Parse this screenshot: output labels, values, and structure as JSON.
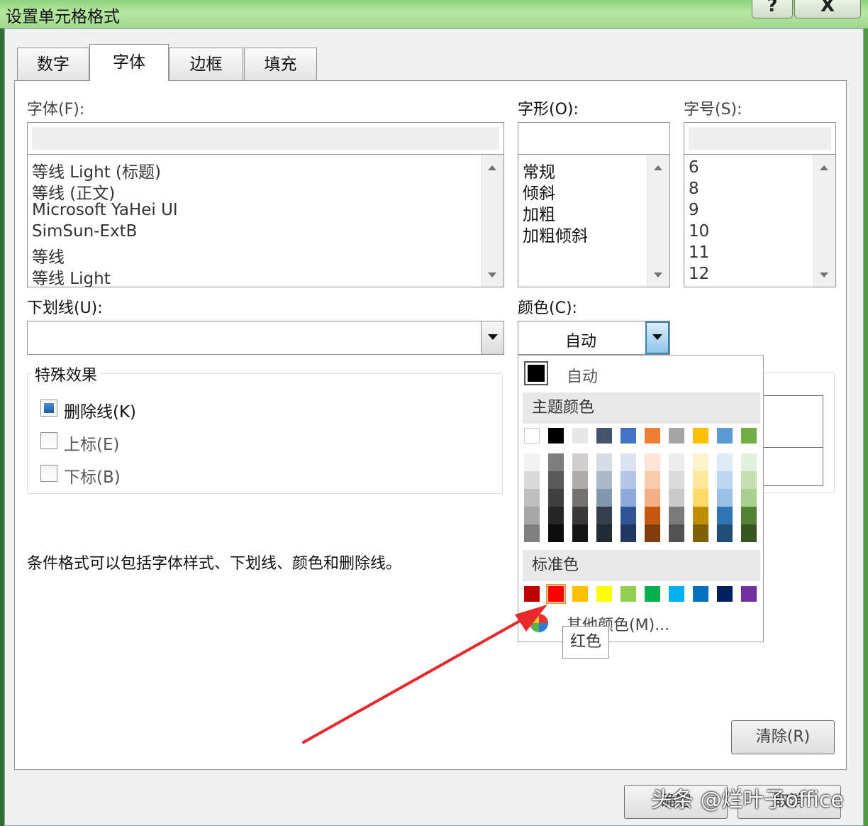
{
  "window": {
    "title": "设置单元格格式",
    "help_glyph": "?",
    "close_glyph": "X"
  },
  "tabs": [
    {
      "label": "数字",
      "active": false
    },
    {
      "label": "字体",
      "active": true
    },
    {
      "label": "边框",
      "active": false
    },
    {
      "label": "填充",
      "active": false
    }
  ],
  "font": {
    "label": "字体(F):",
    "value": "",
    "items": [
      "等线 Light (标题)",
      "等线 (正文)",
      "Microsoft YaHei UI",
      "SimSun-ExtB",
      "等线",
      "等线 Light"
    ]
  },
  "style": {
    "label": "字形(O):",
    "value": "",
    "items": [
      "常规",
      "倾斜",
      "加粗",
      "加粗倾斜"
    ]
  },
  "size": {
    "label": "字号(S):",
    "value": "",
    "items": [
      "6",
      "8",
      "9",
      "10",
      "11",
      "12"
    ]
  },
  "underline": {
    "label": "下划线(U):",
    "value": ""
  },
  "color": {
    "label": "颜色(C):",
    "value": "自动"
  },
  "effects": {
    "title": "特殊效果",
    "strikethrough": {
      "label": "删除线(K)",
      "checked": true
    },
    "superscript": {
      "label": "上标(E)",
      "checked": false
    },
    "subscript": {
      "label": "下标(B)",
      "checked": false
    }
  },
  "note": "条件格式可以包括字体样式、下划线、颜色和删除线。",
  "clear_button": "清除(R)",
  "ok_button": "确定",
  "cancel_button": "取消",
  "color_popup": {
    "auto_label": "自动",
    "theme_header": "主题颜色",
    "theme_top": [
      "#FFFFFF",
      "#000000",
      "#E7E6E6",
      "#44546A",
      "#4472C4",
      "#ED7D31",
      "#A5A5A5",
      "#FFC000",
      "#5B9BD5",
      "#70AD47"
    ],
    "theme_shades": [
      [
        "#F2F2F2",
        "#D9D9D9",
        "#BFBFBF",
        "#A6A6A6",
        "#808080"
      ],
      [
        "#7F7F7F",
        "#595959",
        "#404040",
        "#262626",
        "#0D0D0D"
      ],
      [
        "#D0CECE",
        "#AEAAAA",
        "#757171",
        "#3A3838",
        "#171616"
      ],
      [
        "#D6DCE4",
        "#ACB9CA",
        "#8497B0",
        "#333F4F",
        "#222B35"
      ],
      [
        "#D9E1F2",
        "#B4C6E7",
        "#8EA9DB",
        "#305496",
        "#203764"
      ],
      [
        "#FCE4D6",
        "#F8CBAD",
        "#F4B084",
        "#C65911",
        "#833C0C"
      ],
      [
        "#EDEDED",
        "#DBDBDB",
        "#C9C9C9",
        "#7B7B7B",
        "#525252"
      ],
      [
        "#FFF2CC",
        "#FFE699",
        "#FFD966",
        "#BF8F00",
        "#806000"
      ],
      [
        "#DDEBF7",
        "#BDD7EE",
        "#9BC2E6",
        "#2F75B5",
        "#1F4E78"
      ],
      [
        "#E2EFDA",
        "#C6E0B4",
        "#A9D08E",
        "#548235",
        "#375623"
      ]
    ],
    "standard_header": "标准色",
    "standard": [
      "#C00000",
      "#FF0000",
      "#FFC000",
      "#FFFF00",
      "#92D050",
      "#00B050",
      "#00B0F0",
      "#0070C0",
      "#002060",
      "#7030A0"
    ],
    "selected_standard_index": 1,
    "more_colors": "其他颜色(M)...",
    "tooltip": "红色"
  },
  "annotation_color": "#E8282B",
  "watermark": "头条 @烂叶子office"
}
